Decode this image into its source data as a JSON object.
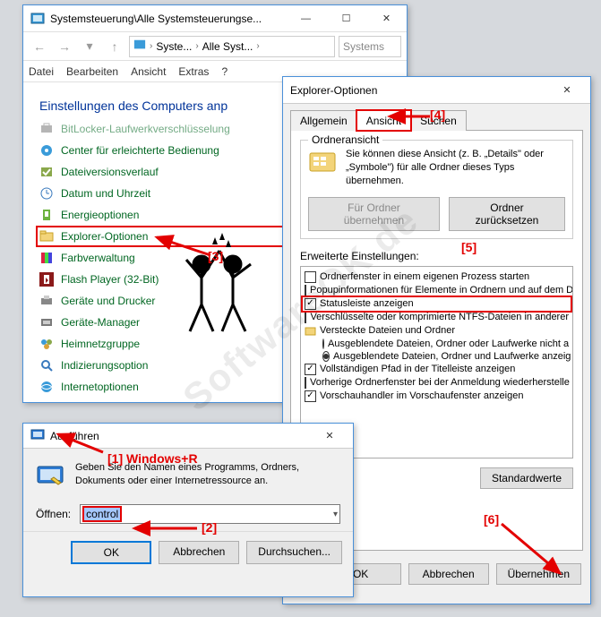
{
  "cp": {
    "title": "Systemsteuerung\\Alle Systemsteuerungse...",
    "breadcrumb": {
      "a": "Syste...",
      "b": "Alle Syst..."
    },
    "search_placeholder": "Systems",
    "menu": {
      "file": "Datei",
      "edit": "Bearbeiten",
      "view": "Ansicht",
      "extras": "Extras",
      "help": "?"
    },
    "heading": "Einstellungen des Computers anp",
    "items": [
      "BitLocker-Laufwerkverschlüsselung",
      "Center für erleichterte Bedienung",
      "Dateiversionsverlauf",
      "Datum und Uhrzeit",
      "Energieoptionen",
      "Explorer-Optionen",
      "Farbverwaltung",
      "Flash Player (32-Bit)",
      "Geräte und Drucker",
      "Geräte-Manager",
      "Heimnetzgruppe",
      "Indizierungsoption",
      "Internetoptionen"
    ]
  },
  "eo": {
    "title": "Explorer-Optionen",
    "tabs": {
      "general": "Allgemein",
      "view": "Ansicht",
      "search": "Suchen"
    },
    "fv": {
      "legend": "Ordneransicht",
      "desc": "Sie können diese Ansicht (z. B. „Details\" oder „Symbole\") für alle Ordner dieses Typs übernehmen.",
      "apply": "Für Ordner übernehmen",
      "reset": "Ordner zurücksetzen"
    },
    "adv_label": "Erweiterte Einstellungen:",
    "tree": [
      {
        "type": "chk",
        "checked": false,
        "label": "Ordnerfenster in einem eigenen Prozess starten"
      },
      {
        "type": "chk",
        "checked": false,
        "label": "Popupinformationen für Elemente in Ordnern und auf dem D"
      },
      {
        "type": "chk",
        "checked": true,
        "label": "Statusleiste anzeigen",
        "highlight": true
      },
      {
        "type": "chk",
        "checked": false,
        "label": "Verschlüsselte oder komprimierte NTFS-Dateien in anderer"
      },
      {
        "type": "fold",
        "label": "Versteckte Dateien und Ordner"
      },
      {
        "type": "rad",
        "checked": false,
        "indent": true,
        "label": "Ausgeblendete Dateien, Ordner oder Laufwerke nicht a"
      },
      {
        "type": "rad",
        "checked": true,
        "indent": true,
        "label": "Ausgeblendete Dateien, Ordner und Laufwerke anzeig"
      },
      {
        "type": "chk",
        "checked": true,
        "label": "Vollständigen Pfad in der Titelleiste anzeigen"
      },
      {
        "type": "chk",
        "checked": false,
        "label": "Vorherige Ordnerfenster bei der Anmeldung wiederherstelle"
      },
      {
        "type": "chk",
        "checked": true,
        "label": "Vorschauhandler im Vorschaufenster anzeigen"
      }
    ],
    "defaults": "Standardwerte",
    "ok": "OK",
    "cancel": "Abbrechen",
    "apply": "Übernehmen"
  },
  "run": {
    "title": "Ausführen",
    "desc": "Geben Sie den Namen eines Programms, Ordners, Dokuments oder einer Internetressource an.",
    "open_label": "Öffnen:",
    "value": "control",
    "ok": "OK",
    "cancel": "Abbrechen",
    "browse": "Durchsuchen..."
  },
  "ann": {
    "k1": "[1] Windows+R",
    "k2": "[2]",
    "k3": "[3]",
    "k4": "[4]",
    "k5": "[5]",
    "k6": "[6]",
    "wm": "SoftwareOK.de"
  }
}
